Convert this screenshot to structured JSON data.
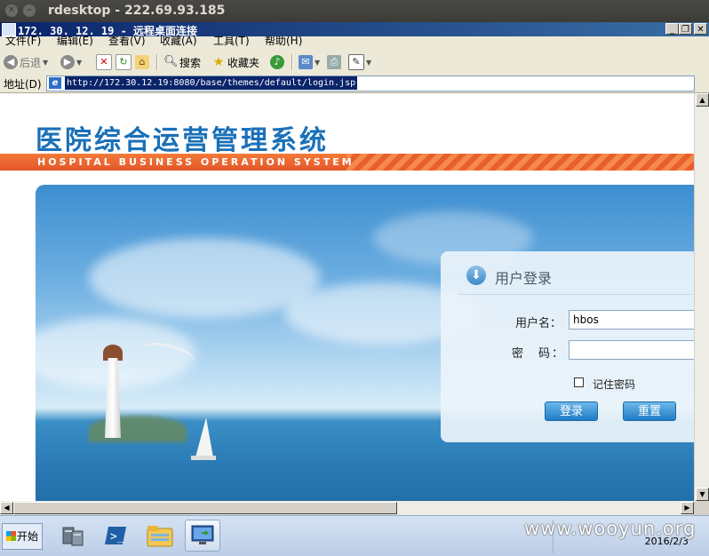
{
  "outer_window": {
    "title": "rdesktop - 222.69.93.185",
    "close_glyph": "✕",
    "minimize_glyph": "–"
  },
  "rd_window": {
    "title": "172. 30. 12. 19 - 远程桌面连接",
    "buttons": {
      "minimize": "_",
      "restore": "❐",
      "close": "✕"
    }
  },
  "menu": [
    "文件(F)",
    "编辑(E)",
    "查看(V)",
    "收藏(A)",
    "工具(T)",
    "帮助(H)"
  ],
  "toolbar": {
    "back_label": "后退",
    "search_label": "搜索",
    "favorites_label": "收藏夹"
  },
  "address": {
    "label": "地址(D)",
    "url": "http://172.30.12.19:8080/base/themes/default/login.jsp"
  },
  "page": {
    "logo_cn": "医院综合运营管理系统",
    "logo_en": "HOSPITAL BUSINESS OPERATION SYSTEM",
    "login": {
      "title": "用户登录",
      "username_label": "用户名：",
      "username_value": "hbos",
      "password_label": "密　码：",
      "password_value": "",
      "remember_label": "记住密码",
      "remember_checked": false,
      "login_button": "登录",
      "reset_button": "重置"
    }
  },
  "taskbar": {
    "start_label": "开始",
    "apps": [
      "server-manager-icon",
      "powershell-icon",
      "explorer-folder-icon",
      "remote-desktop-icon"
    ],
    "clock_date": "2016/2/3"
  },
  "watermark": "www.wooyun.org",
  "colors": {
    "brand_blue": "#1a70b8",
    "band_orange": "#e5552a",
    "button_blue": "#1f7cc5"
  }
}
